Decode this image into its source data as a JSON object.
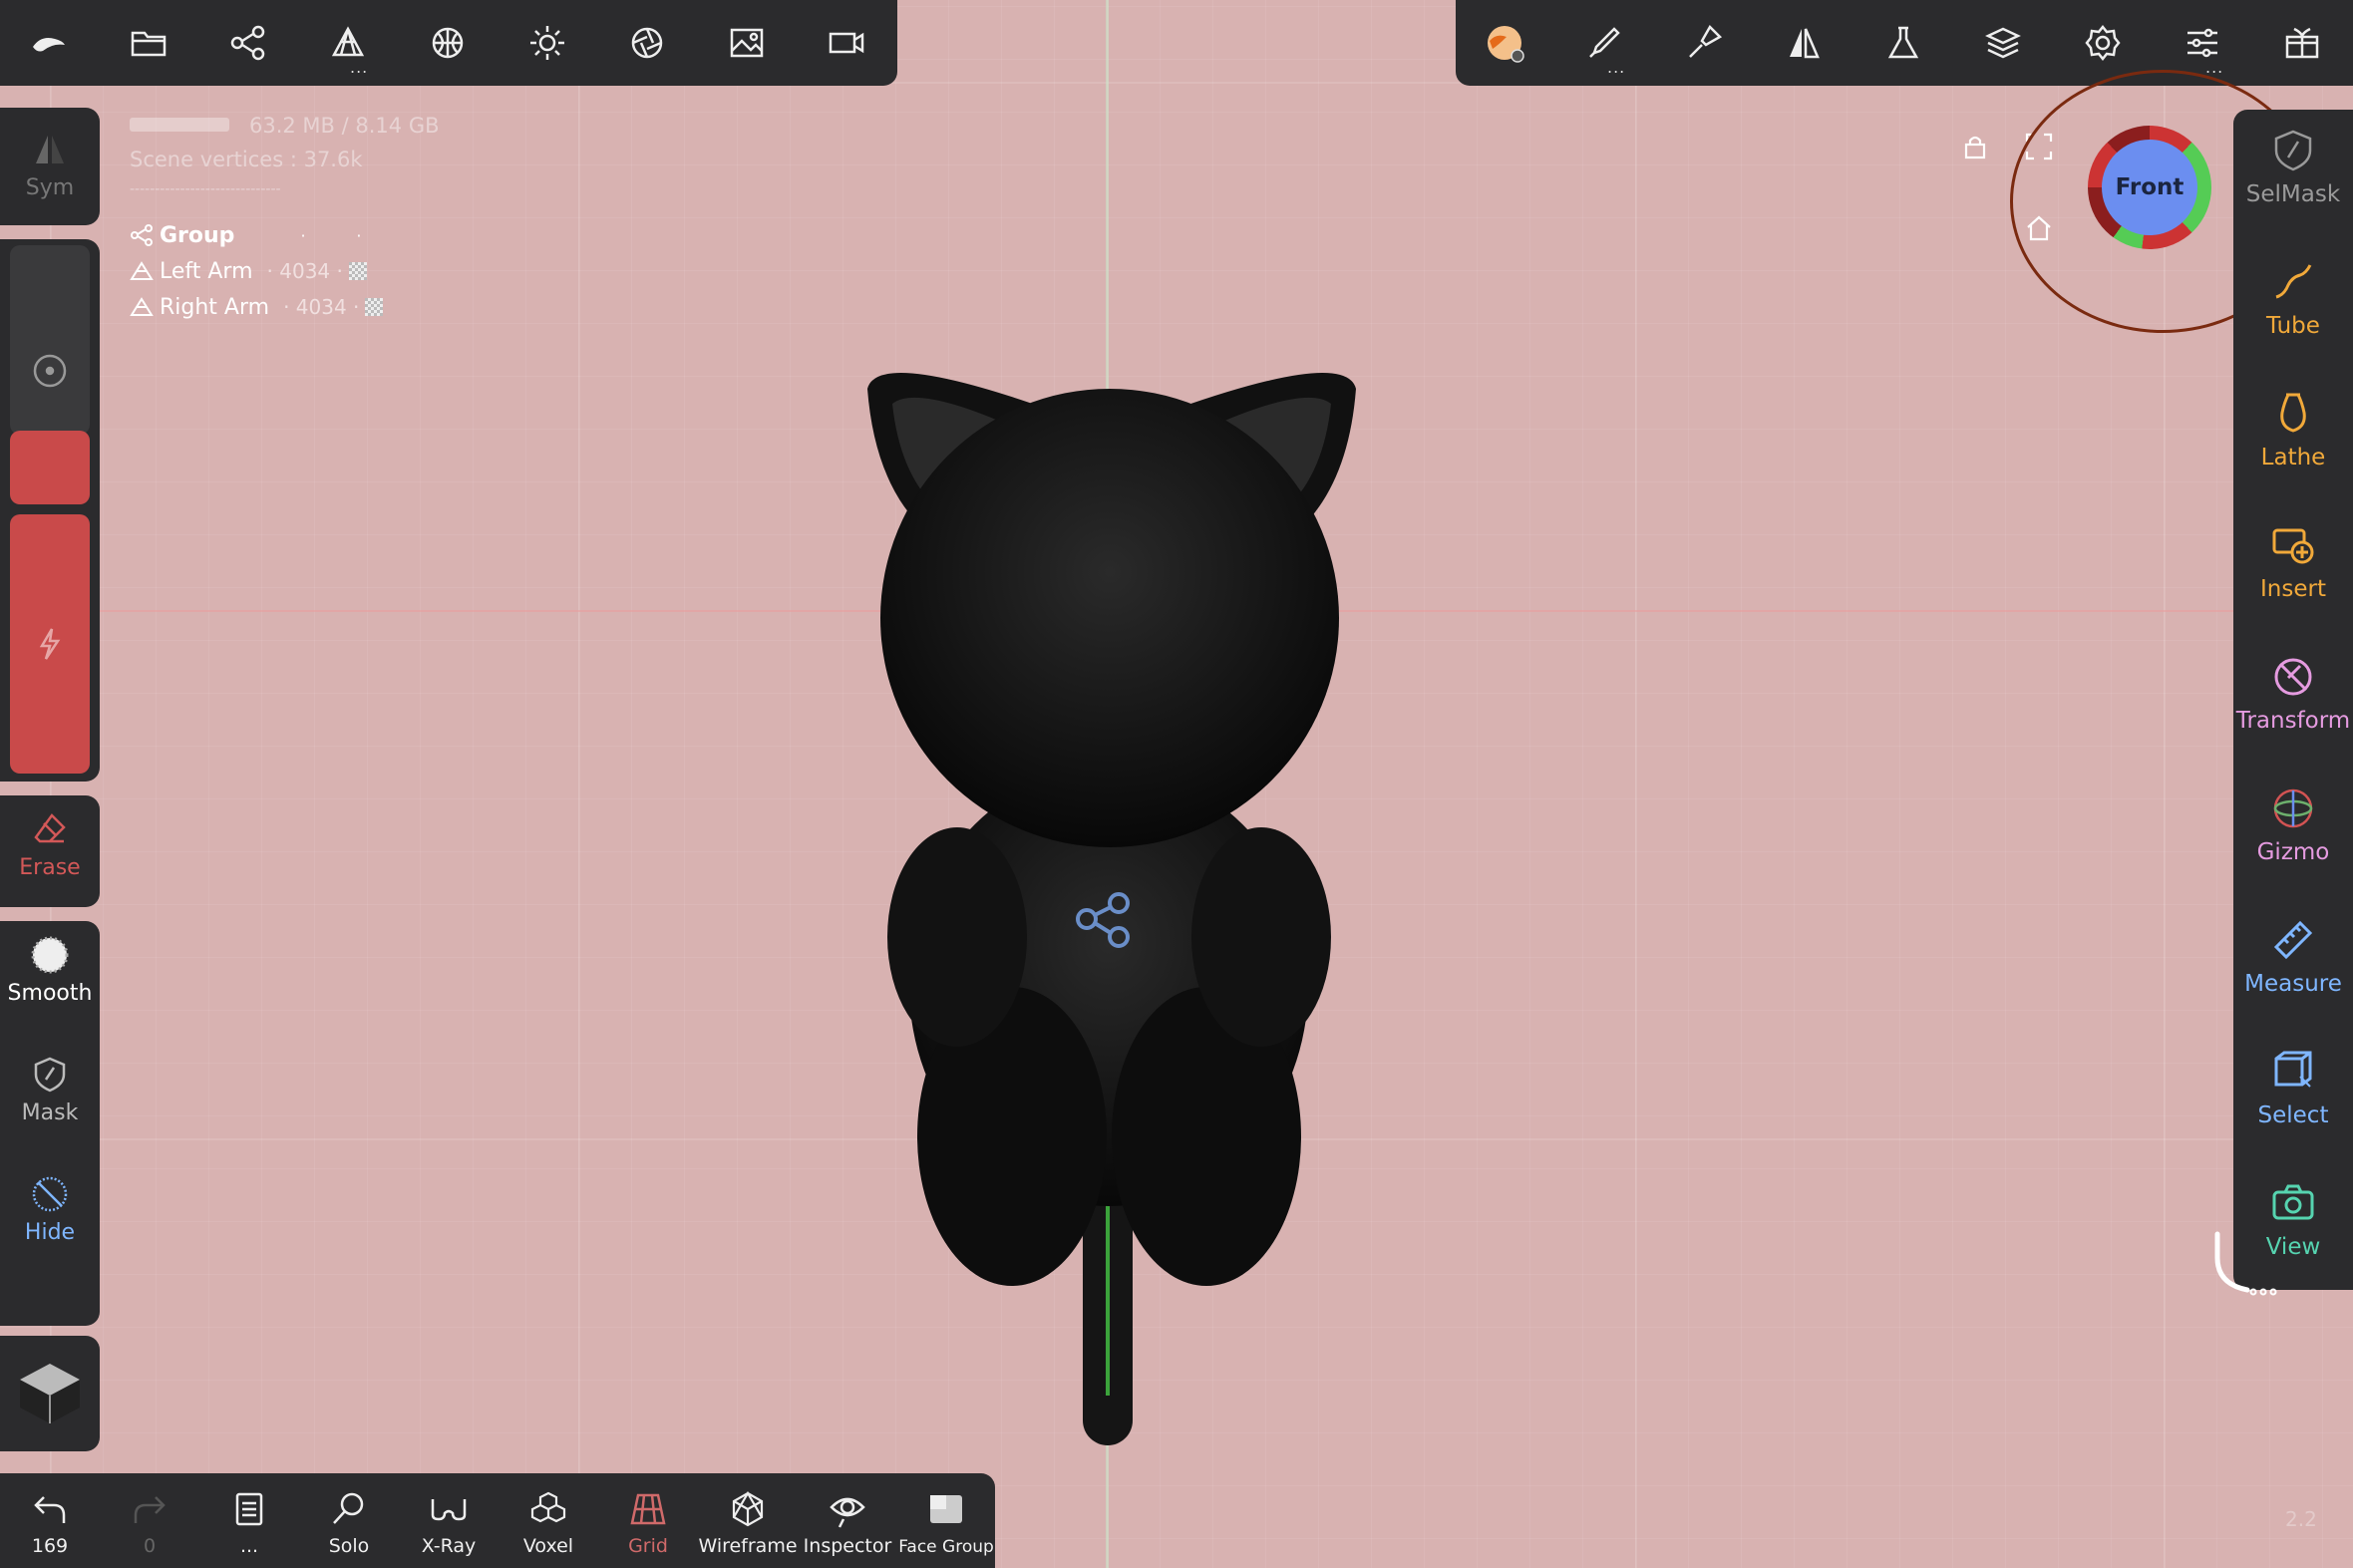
{
  "stats": {
    "memory": "63.2 MB / 8.14 GB",
    "scene_vertices": "Scene vertices : 37.6k",
    "separator": "------------------------------"
  },
  "scene_tree": {
    "group": "Group",
    "items": [
      {
        "name": "Left Arm",
        "verts": "· 4034 ·"
      },
      {
        "name": "Right Arm",
        "verts": "· 4034 ·"
      }
    ]
  },
  "left_tools": {
    "sym": "Sym",
    "erase": "Erase",
    "smooth": "Smooth",
    "mask": "Mask",
    "hide": "Hide"
  },
  "right_tools": [
    {
      "label": "SelMask",
      "icon": "selmask-icon",
      "color": "#9a9a9a"
    },
    {
      "label": "Tube",
      "icon": "tube-icon",
      "color": "#f1a93a"
    },
    {
      "label": "Lathe",
      "icon": "lathe-icon",
      "color": "#f1a93a"
    },
    {
      "label": "Insert",
      "icon": "insert-icon",
      "color": "#f1a93a"
    },
    {
      "label": "Transform",
      "icon": "transform-icon",
      "color": "#e59be0"
    },
    {
      "label": "Gizmo",
      "icon": "gizmo-icon",
      "color": "#e59be0"
    },
    {
      "label": "Measure",
      "icon": "measure-icon",
      "color": "#7fb6ff"
    },
    {
      "label": "Select",
      "icon": "select-icon",
      "color": "#7fb6ff"
    },
    {
      "label": "View",
      "icon": "camera-icon",
      "color": "#56d4b0"
    }
  ],
  "bottom_tools": {
    "undo": "169",
    "redo": "0",
    "files": "...",
    "solo": "Solo",
    "xray": "X-Ray",
    "voxel": "Voxel",
    "grid": "Grid",
    "wireframe": "Wireframe",
    "inspector": "Inspector",
    "facegroup": "Face Group"
  },
  "nav_cube": {
    "face": "Front"
  },
  "version": "2.2",
  "colors": {
    "background": "#d8b2b1",
    "toolbar": "#2b2b2d",
    "accent_red": "#c94a4a",
    "grid_active": "#d06a6a"
  }
}
